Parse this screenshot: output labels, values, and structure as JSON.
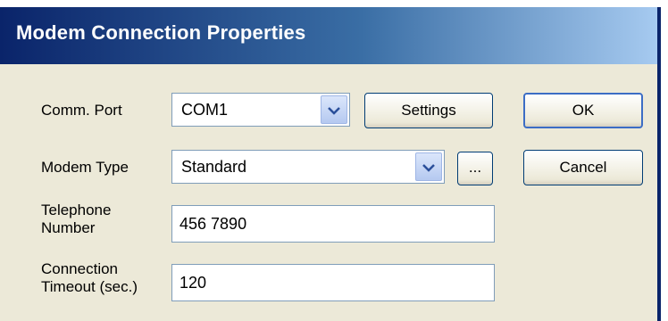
{
  "window": {
    "title": "Modem Connection Properties"
  },
  "fields": {
    "comm_port": {
      "label": "Comm. Port",
      "value": "COM1"
    },
    "modem_type": {
      "label": "Modem Type",
      "value": "Standard"
    },
    "telephone": {
      "label_line1": "Telephone",
      "label_line2": "Number",
      "value": "456 7890"
    },
    "timeout": {
      "label_line1": "Connection",
      "label_line2": "Timeout (sec.)",
      "value": "120"
    }
  },
  "buttons": {
    "settings": "Settings",
    "ellipsis": "...",
    "ok": "OK",
    "cancel": "Cancel"
  },
  "colors": {
    "titlebar_start": "#0a246a",
    "titlebar_end": "#a6caf0",
    "window_bg": "#ece9d8",
    "field_border": "#7f9db9"
  }
}
